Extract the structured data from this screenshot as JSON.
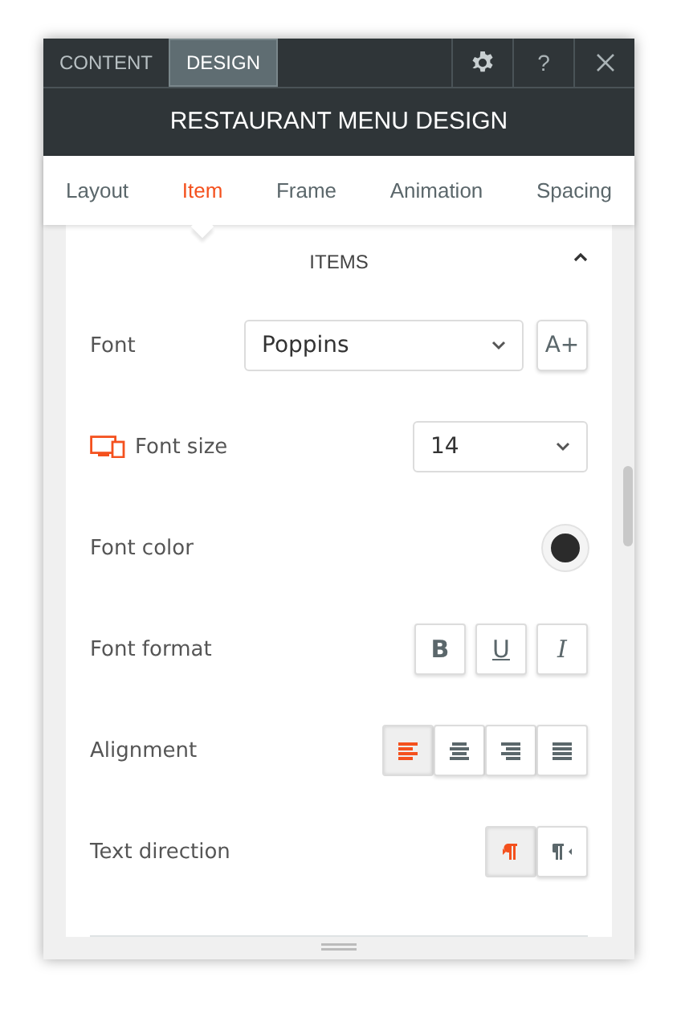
{
  "top_tabs": [
    {
      "label": "CONTENT",
      "selected": false
    },
    {
      "label": "DESIGN",
      "selected": true
    }
  ],
  "toolbar": {
    "help": "?"
  },
  "header": {
    "title": "RESTAURANT MENU DESIGN"
  },
  "sub_tabs": [
    {
      "label": "Layout",
      "selected": false
    },
    {
      "label": "Item",
      "selected": true
    },
    {
      "label": "Frame",
      "selected": false
    },
    {
      "label": "Animation",
      "selected": false
    },
    {
      "label": "Spacing",
      "selected": false
    }
  ],
  "section": {
    "title": "ITEMS",
    "expanded": true
  },
  "rows": [
    {
      "kind": "select",
      "label": "Font",
      "value": "Poppins",
      "extra": "A+"
    },
    {
      "kind": "size",
      "label": "Font size",
      "value": "14"
    },
    {
      "kind": "color",
      "label": "Font color",
      "color": "#2b2b2b"
    },
    {
      "kind": "format",
      "label": "Font format",
      "buttons": [
        {
          "kind": "bold",
          "label": "B",
          "selected": false
        },
        {
          "kind": "underline",
          "label": "U",
          "selected": false
        },
        {
          "kind": "italic",
          "label": "I",
          "selected": false
        }
      ]
    },
    {
      "kind": "align",
      "label": "Alignment",
      "buttons": [
        {
          "kind": "left",
          "selected": true
        },
        {
          "kind": "center",
          "selected": false
        },
        {
          "kind": "right",
          "selected": false
        },
        {
          "kind": "justify",
          "selected": false
        }
      ]
    },
    {
      "kind": "direction",
      "label": "Text direction",
      "buttons": [
        {
          "kind": "ltr",
          "selected": true
        },
        {
          "kind": "rtl",
          "selected": false
        }
      ]
    }
  ]
}
